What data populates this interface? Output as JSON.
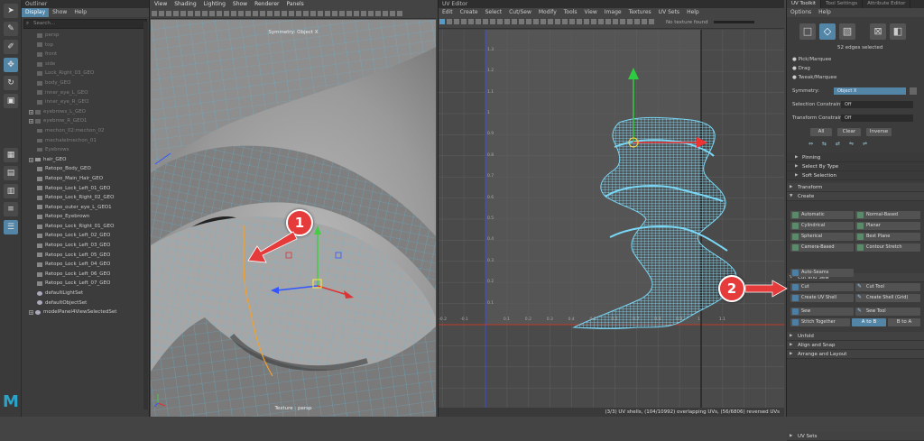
{
  "outliner": {
    "title": "Outliner",
    "menu": [
      "Display",
      "Show",
      "Help"
    ],
    "search_placeholder": "Search...",
    "items": [
      {
        "label": "persp",
        "dim": true,
        "icon": "camera-icon"
      },
      {
        "label": "top",
        "dim": true,
        "icon": "camera-icon"
      },
      {
        "label": "front",
        "dim": true,
        "icon": "camera-icon"
      },
      {
        "label": "side",
        "dim": true,
        "icon": "camera-icon"
      },
      {
        "label": "Lock_Right_03_GEO",
        "dim": true,
        "icon": "mesh-icon"
      },
      {
        "label": "body_GEO",
        "dim": true,
        "icon": "mesh-icon"
      },
      {
        "label": "inner_eye_L_GEO",
        "dim": true,
        "icon": "mesh-icon"
      },
      {
        "label": "inner_eye_R_GEO",
        "dim": true,
        "icon": "mesh-icon"
      },
      {
        "label": "eyebrows_L_GEO",
        "dim": true,
        "icon": "joint-icon",
        "expand": true
      },
      {
        "label": "eyebrow_R_GEO1",
        "dim": true,
        "icon": "joint-icon",
        "expand": true
      },
      {
        "label": "mechon_02:mechon_02",
        "dim": true,
        "icon": "group-icon"
      },
      {
        "label": "mechalelmechon_01",
        "dim": true,
        "icon": "group-icon"
      },
      {
        "label": "Eyebrows",
        "dim": true,
        "icon": "group-icon"
      },
      {
        "label": "hair_GEO",
        "dim": false,
        "icon": "group-icon",
        "expand": true
      },
      {
        "label": "Retopo_Body_GEO",
        "dim": false,
        "icon": "mesh-icon"
      },
      {
        "label": "Retopo_Main_Hair_GEO",
        "dim": false,
        "icon": "mesh-icon"
      },
      {
        "label": "Retopo_Lock_Left_01_GEO",
        "dim": false,
        "icon": "mesh-icon"
      },
      {
        "label": "Retopo_Lock_Right_02_GEO",
        "dim": false,
        "icon": "mesh-icon"
      },
      {
        "label": "Retopo_outer_eye_L_GEO1",
        "dim": false,
        "icon": "mesh-icon"
      },
      {
        "label": "Retopo_Eyebrown",
        "dim": false,
        "icon": "mesh-icon"
      },
      {
        "label": "Retopo_Lock_Right_01_GEO",
        "dim": false,
        "icon": "mesh-icon"
      },
      {
        "label": "Retopo_Lock_Left_02_GEO",
        "dim": false,
        "icon": "mesh-icon"
      },
      {
        "label": "Retopo_Lock_Left_03_GEO",
        "dim": false,
        "icon": "mesh-icon"
      },
      {
        "label": "Retopo_Lock_Left_05_GEO",
        "dim": false,
        "icon": "mesh-icon"
      },
      {
        "label": "Retopo_Lock_Left_04_GEO",
        "dim": false,
        "icon": "mesh-icon"
      },
      {
        "label": "Retopo_Lock_Left_06_GEO",
        "dim": false,
        "icon": "mesh-icon"
      },
      {
        "label": "Retopo_Lock_Left_07_GEO",
        "dim": false,
        "icon": "mesh-icon"
      },
      {
        "label": "defaultLightSet",
        "dim": false,
        "icon": "set-icon"
      },
      {
        "label": "defaultObjectSet",
        "dim": false,
        "icon": "set-icon"
      },
      {
        "label": "modelPanel4ViewSelectedSet",
        "dim": false,
        "icon": "set-icon",
        "expand": true
      }
    ]
  },
  "viewport": {
    "menu": [
      "View",
      "Shading",
      "Lighting",
      "Show",
      "Renderer",
      "Panels"
    ],
    "hud_top": "Symmetry: Object X",
    "hud_bottom": "Texture : persp"
  },
  "uv_editor": {
    "title": "UV Editor",
    "menu": [
      "Edit",
      "Create",
      "Select",
      "Cut/Sew",
      "Modify",
      "Tools",
      "View",
      "Image",
      "Textures",
      "UV Sets",
      "Help"
    ],
    "texture_label": "No texture found",
    "status": "(3/3) UV shells, (104/10992) overlapping UVs, (56/6806) reversed UVs",
    "x_ticks": [
      "-0.2",
      "-0.1",
      "0.1",
      "0.2",
      "0.3",
      "0.4",
      "0.5",
      "0.6",
      "0.7",
      "0.8",
      "0.9",
      "1",
      "1.1"
    ],
    "y_ticks": [
      "1.3",
      "1.2",
      "1.1",
      "1",
      "0.9",
      "0.8",
      "0.7",
      "0.6",
      "0.5",
      "0.4",
      "0.3",
      "0.2",
      "0.1"
    ]
  },
  "toolkit": {
    "tabs": [
      "UV Toolkit",
      "Tool Settings",
      "Attribute Editor"
    ],
    "menu": [
      "Options",
      "Help"
    ],
    "selected_info": "52 edges selected",
    "modes": [
      "Pick/Marquee",
      "Drag",
      "Tweak/Marquee"
    ],
    "symmetry_label": "Symmetry:",
    "symmetry_value": "Object X",
    "selection_constraint_label": "Selection Constraint:",
    "selection_constraint_value": "Off",
    "transform_constraint_label": "Transform Constraint:",
    "transform_constraint_value": "Off",
    "all_label": "All",
    "clear_label": "Clear",
    "inverse_label": "Inverse",
    "sections": {
      "pinning": "Pinning",
      "select_by_type": "Select By Type",
      "soft_selection": "Soft Selection",
      "transform": "Transform",
      "create": "Create",
      "cut_and_sew": "Cut and Sew",
      "unfold": "Unfold",
      "align_and_snap": "Align and Snap",
      "arrange_and_layout": "Arrange and Layout",
      "uv_sets": "UV Sets"
    },
    "create_buttons": [
      "Automatic",
      "Normal-Based",
      "Cylindrical",
      "Planar",
      "Spherical",
      "Best Plane",
      "Camera-Based",
      "Contour Stretch"
    ],
    "auto_seams": "Auto-Seams",
    "cut_buttons": [
      "Cut",
      "Cut Tool",
      "Create UV Shell",
      "Create Shell (Grid)",
      "Sew",
      "Sew Tool",
      "Stitch Together"
    ],
    "a_to_b": "A to B",
    "b_to_a": "B to A"
  },
  "annotations": [
    "1",
    "2"
  ],
  "colors": {
    "accent": "#5285a6",
    "uv_wire": "#7ad7f5",
    "callout": "#e53b3b"
  }
}
